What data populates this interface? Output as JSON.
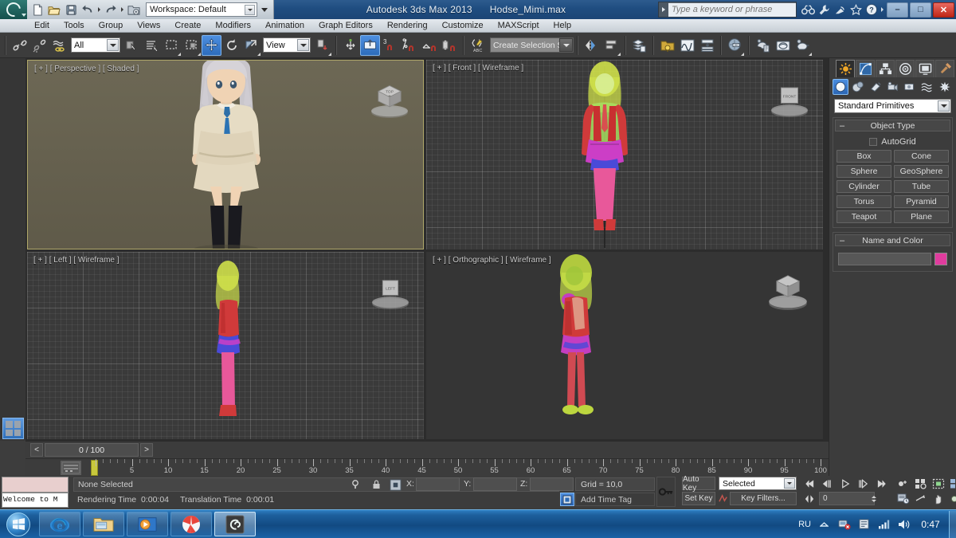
{
  "app": {
    "title": "Autodesk 3ds Max  2013",
    "filename": "Hodse_Mimi.max",
    "workspace_label": "Workspace: Default",
    "logo_icon": "3dsmax-swirl-icon"
  },
  "quick_access": [
    {
      "name": "new-file-icon",
      "label": "New"
    },
    {
      "name": "open-file-icon",
      "label": "Open"
    },
    {
      "name": "save-file-icon",
      "label": "Save"
    },
    {
      "name": "undo-icon",
      "label": "Undo"
    },
    {
      "name": "redo-icon",
      "label": "Redo"
    },
    {
      "name": "set-project-folder-icon",
      "label": "Set Project Folder"
    }
  ],
  "window_controls": {
    "minimize": "–",
    "maximize": "□",
    "close": "✕"
  },
  "search": {
    "placeholder": "Type a keyword or phrase",
    "icons": [
      "binoculars-icon",
      "wrench-icon",
      "satellite-dish-icon",
      "star-icon",
      "help-icon",
      "chevron-down-icon"
    ]
  },
  "menu": {
    "items": [
      "Edit",
      "Tools",
      "Group",
      "Views",
      "Create",
      "Modifiers",
      "Animation",
      "Graph Editors",
      "Rendering",
      "Customize",
      "MAXScript",
      "Help"
    ]
  },
  "toolbar": {
    "selection_filter": "All",
    "reference_coord": "View",
    "named_selection_set": "Create Selection Se",
    "snap_angle": "3",
    "icons": [
      "select-link-icon",
      "unlink-icon",
      "bind-to-space-warp-icon",
      "select-object-icon",
      "select-by-name-icon",
      "rectangular-selection-region-icon",
      "window-crossing-icon",
      "select-and-move-icon",
      "select-and-rotate-icon",
      "select-and-scale-icon",
      "use-center-flyout-icon",
      "select-and-manipulate-icon",
      "snaps-toggle-icon",
      "angle-snap-toggle-icon",
      "percent-snap-toggle-icon",
      "spinner-snap-toggle-icon",
      "edit-named-selection-sets-icon",
      "mirror-icon",
      "align-icon",
      "layer-manager-icon",
      "scene-explorer-icon",
      "curve-editor-icon",
      "schematic-view-icon",
      "material-editor-icon",
      "render-setup-icon",
      "rendered-frame-window-icon",
      "render-production-icon"
    ]
  },
  "left_rail": {
    "expand_icon": "expand-arrow-icon",
    "viewport_layout_icon": "viewport-layout-quad-icon"
  },
  "viewports": [
    {
      "name": "viewport-perspective",
      "label": "[ + ] [ Perspective ] [ Shaded ]",
      "view": "Perspective",
      "shading": "Shaded",
      "active": true
    },
    {
      "name": "viewport-front",
      "label": "[ + ] [ Front ] [ Wireframe ]",
      "view": "Front",
      "shading": "Wireframe",
      "active": false
    },
    {
      "name": "viewport-left",
      "label": "[ + ] [ Left ] [ Wireframe ]",
      "view": "Left",
      "shading": "Wireframe",
      "active": false
    },
    {
      "name": "viewport-orthographic",
      "label": "[ + ] [ Orthographic ] [ Wireframe ]",
      "view": "Orthographic",
      "shading": "Wireframe",
      "active": false
    }
  ],
  "command_panel": {
    "tabs": [
      {
        "name": "tab-create",
        "icon": "create-star-icon",
        "selected": true
      },
      {
        "name": "tab-modify",
        "icon": "modify-curve-icon",
        "selected": false
      },
      {
        "name": "tab-hierarchy",
        "icon": "hierarchy-icon",
        "selected": false
      },
      {
        "name": "tab-motion",
        "icon": "motion-wheel-icon",
        "selected": false
      },
      {
        "name": "tab-display",
        "icon": "display-monitor-icon",
        "selected": false
      },
      {
        "name": "tab-utilities",
        "icon": "utilities-hammer-icon",
        "selected": false
      }
    ],
    "categories": [
      {
        "name": "category-geometry",
        "icon": "geometry-sphere-icon",
        "selected": true
      },
      {
        "name": "category-shapes",
        "icon": "shapes-icon",
        "selected": false
      },
      {
        "name": "category-lights",
        "icon": "lights-icon",
        "selected": false
      },
      {
        "name": "category-cameras",
        "icon": "camera-icon",
        "selected": false
      },
      {
        "name": "category-helpers",
        "icon": "helpers-icon",
        "selected": false
      },
      {
        "name": "category-space-warps",
        "icon": "space-warps-icon",
        "selected": false
      },
      {
        "name": "category-systems",
        "icon": "systems-icon",
        "selected": false
      }
    ],
    "primitive_dropdown": "Standard Primitives",
    "rollouts": [
      {
        "name": "rollout-object-type",
        "title": "Object Type",
        "autogrid_label": "AutoGrid",
        "autogrid_checked": false,
        "buttons": [
          "Box",
          "Cone",
          "Sphere",
          "GeoSphere",
          "Cylinder",
          "Tube",
          "Torus",
          "Pyramid",
          "Teapot",
          "Plane"
        ]
      },
      {
        "name": "rollout-name-and-color",
        "title": "Name and Color",
        "name_value": "",
        "color": "#e03c9e"
      }
    ]
  },
  "timeline": {
    "current_frame_label": "0 / 100",
    "prev_button": "<",
    "next_button": ">",
    "start": 0,
    "end": 100,
    "tick_labels": [
      0,
      5,
      10,
      15,
      20,
      25,
      30,
      35,
      40,
      45,
      50,
      55,
      60,
      65,
      70,
      75,
      80,
      85,
      90,
      95,
      100
    ],
    "current_frame": 0
  },
  "status_bar": {
    "mini_listener_text": "Welcome to M",
    "prompt": "None Selected",
    "rendering_time_label": "Rendering Time",
    "rendering_time": "0:00:04",
    "translation_time_label": "Translation Time",
    "translation_time": "0:00:01",
    "x_label": "X:",
    "y_label": "Y:",
    "z_label": "Z:",
    "x_value": "",
    "y_value": "",
    "z_value": "",
    "grid_text": "Grid = 10,0",
    "add_time_tag": "Add Time Tag",
    "icons": [
      "isolate-selection-icon",
      "lock-selection-icon",
      "absolute-relative-transform-icon",
      "key-mode-icon"
    ]
  },
  "animation_bar": {
    "auto_key": "Auto Key",
    "set_key": "Set Key",
    "key_filters": "Key Filters...",
    "selection_level": "Selected",
    "frame_spinner": "0",
    "playback_icons": [
      "go-to-start-icon",
      "previous-frame-icon",
      "play-animation-icon",
      "next-frame-icon",
      "go-to-end-icon",
      "key-mode-toggle-icon"
    ],
    "nav_icons": [
      "zoom-icon",
      "zoom-all-icon",
      "zoom-extents-icon",
      "zoom-region-icon",
      "pan-view-icon",
      "orbit-icon",
      "maximize-viewport-toggle-icon",
      "field-of-view-icon",
      "time-configuration-icon"
    ]
  },
  "taskbar": {
    "start_icon": "windows-start-orb-icon",
    "items": [
      {
        "name": "taskbar-internet-explorer",
        "icon": "internet-explorer-icon",
        "active": false
      },
      {
        "name": "taskbar-file-explorer",
        "icon": "file-explorer-icon",
        "active": false
      },
      {
        "name": "taskbar-media-player",
        "icon": "media-player-icon",
        "active": false
      },
      {
        "name": "taskbar-yandex-browser",
        "icon": "yandex-browser-icon",
        "active": false
      },
      {
        "name": "taskbar-3ds-max",
        "icon": "3dsmax-swirl-icon",
        "active": true
      }
    ],
    "tray": {
      "language": "RU",
      "show_hidden_icon": "chevron-up-icon",
      "icons": [
        "network-error-icon",
        "action-center-icon",
        "signal-bars-icon",
        "volume-icon"
      ],
      "clock": "0:47"
    }
  }
}
